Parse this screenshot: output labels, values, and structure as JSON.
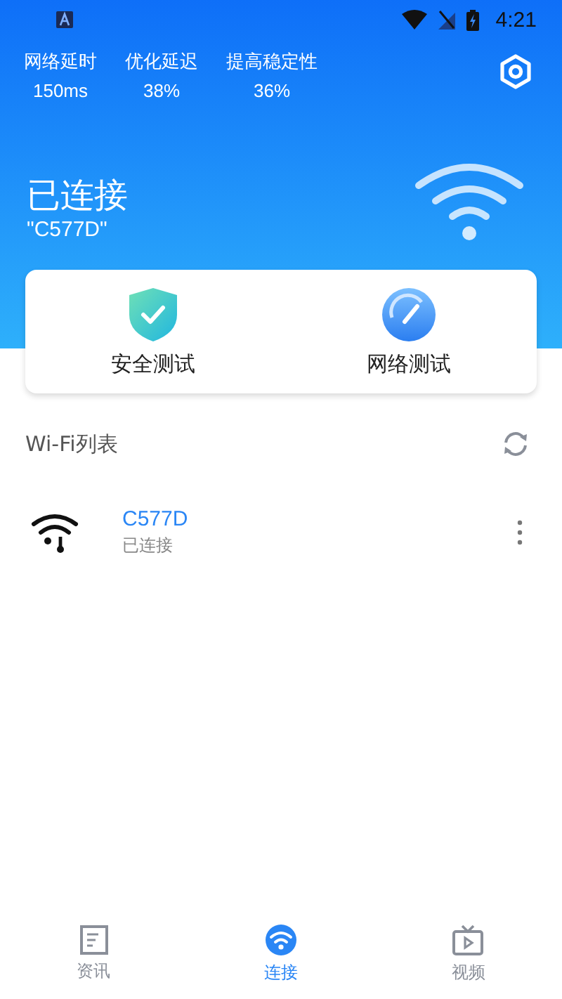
{
  "status_bar": {
    "time": "4:21"
  },
  "stats": [
    {
      "label": "网络延时",
      "value": "150ms"
    },
    {
      "label": "优化延迟",
      "value": "38%"
    },
    {
      "label": "提高稳定性",
      "value": "36%"
    }
  ],
  "connection": {
    "status": "已连接",
    "ssid": "\"C577D\""
  },
  "actions": [
    {
      "kind": "shield",
      "label": "安全测试"
    },
    {
      "kind": "gauge",
      "label": "网络测试"
    }
  ],
  "wifi_list": {
    "title": "Wi-Fi列表",
    "networks": [
      {
        "name": "C577D",
        "status": "已连接",
        "connected": true
      }
    ]
  },
  "tabs": [
    {
      "kind": "news",
      "label": "资讯",
      "selected": false
    },
    {
      "kind": "connect",
      "label": "连接",
      "selected": true
    },
    {
      "kind": "video",
      "label": "视频",
      "selected": false
    }
  ]
}
